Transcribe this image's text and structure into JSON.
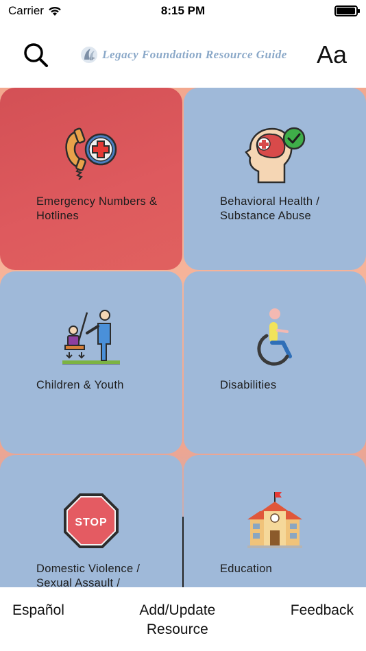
{
  "status_bar": {
    "carrier": "Carrier",
    "time": "8:15 PM",
    "battery_level": 0.95
  },
  "header": {
    "title": "Legacy Foundation Resource Guide",
    "font_size_label": "Aa",
    "icons": {
      "search": "search-icon",
      "logo": "legacy-logo-icon"
    }
  },
  "categories": [
    {
      "label": "Emergency Numbers & Hotlines",
      "icon": "phone-medical-cross-icon",
      "highlight": true
    },
    {
      "label": "Behavioral Health / Substance Abuse",
      "icon": "head-brain-check-icon"
    },
    {
      "label": "Children & Youth",
      "icon": "child-adult-teaching-icon"
    },
    {
      "label": "Disabilities",
      "icon": "wheelchair-icon"
    },
    {
      "label": "Domestic Violence / Sexual Assault /",
      "icon": "stop-sign-icon",
      "sign_text": "STOP"
    },
    {
      "label": "Education",
      "icon": "school-building-icon"
    }
  ],
  "bottom_bar": {
    "espanol": "Español",
    "add_update": "Add/Update Resource",
    "feedback": "Feedback"
  },
  "colors": {
    "highlight_tile": "#d8555a",
    "tile": "#9fb9d9",
    "brand_text": "#8aa8c8"
  }
}
